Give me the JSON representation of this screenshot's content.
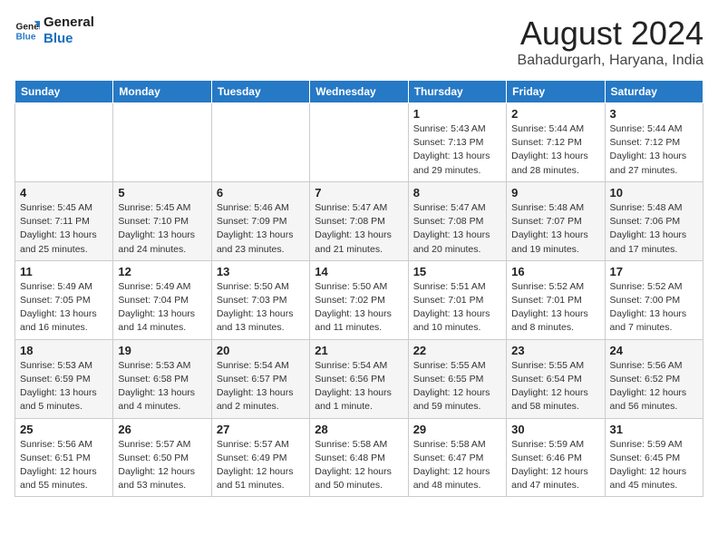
{
  "header": {
    "logo_line1": "General",
    "logo_line2": "Blue",
    "month": "August 2024",
    "location": "Bahadurgarh, Haryana, India"
  },
  "weekdays": [
    "Sunday",
    "Monday",
    "Tuesday",
    "Wednesday",
    "Thursday",
    "Friday",
    "Saturday"
  ],
  "weeks": [
    [
      {
        "day": "",
        "info": ""
      },
      {
        "day": "",
        "info": ""
      },
      {
        "day": "",
        "info": ""
      },
      {
        "day": "",
        "info": ""
      },
      {
        "day": "1",
        "info": "Sunrise: 5:43 AM\nSunset: 7:13 PM\nDaylight: 13 hours\nand 29 minutes."
      },
      {
        "day": "2",
        "info": "Sunrise: 5:44 AM\nSunset: 7:12 PM\nDaylight: 13 hours\nand 28 minutes."
      },
      {
        "day": "3",
        "info": "Sunrise: 5:44 AM\nSunset: 7:12 PM\nDaylight: 13 hours\nand 27 minutes."
      }
    ],
    [
      {
        "day": "4",
        "info": "Sunrise: 5:45 AM\nSunset: 7:11 PM\nDaylight: 13 hours\nand 25 minutes."
      },
      {
        "day": "5",
        "info": "Sunrise: 5:45 AM\nSunset: 7:10 PM\nDaylight: 13 hours\nand 24 minutes."
      },
      {
        "day": "6",
        "info": "Sunrise: 5:46 AM\nSunset: 7:09 PM\nDaylight: 13 hours\nand 23 minutes."
      },
      {
        "day": "7",
        "info": "Sunrise: 5:47 AM\nSunset: 7:08 PM\nDaylight: 13 hours\nand 21 minutes."
      },
      {
        "day": "8",
        "info": "Sunrise: 5:47 AM\nSunset: 7:08 PM\nDaylight: 13 hours\nand 20 minutes."
      },
      {
        "day": "9",
        "info": "Sunrise: 5:48 AM\nSunset: 7:07 PM\nDaylight: 13 hours\nand 19 minutes."
      },
      {
        "day": "10",
        "info": "Sunrise: 5:48 AM\nSunset: 7:06 PM\nDaylight: 13 hours\nand 17 minutes."
      }
    ],
    [
      {
        "day": "11",
        "info": "Sunrise: 5:49 AM\nSunset: 7:05 PM\nDaylight: 13 hours\nand 16 minutes."
      },
      {
        "day": "12",
        "info": "Sunrise: 5:49 AM\nSunset: 7:04 PM\nDaylight: 13 hours\nand 14 minutes."
      },
      {
        "day": "13",
        "info": "Sunrise: 5:50 AM\nSunset: 7:03 PM\nDaylight: 13 hours\nand 13 minutes."
      },
      {
        "day": "14",
        "info": "Sunrise: 5:50 AM\nSunset: 7:02 PM\nDaylight: 13 hours\nand 11 minutes."
      },
      {
        "day": "15",
        "info": "Sunrise: 5:51 AM\nSunset: 7:01 PM\nDaylight: 13 hours\nand 10 minutes."
      },
      {
        "day": "16",
        "info": "Sunrise: 5:52 AM\nSunset: 7:01 PM\nDaylight: 13 hours\nand 8 minutes."
      },
      {
        "day": "17",
        "info": "Sunrise: 5:52 AM\nSunset: 7:00 PM\nDaylight: 13 hours\nand 7 minutes."
      }
    ],
    [
      {
        "day": "18",
        "info": "Sunrise: 5:53 AM\nSunset: 6:59 PM\nDaylight: 13 hours\nand 5 minutes."
      },
      {
        "day": "19",
        "info": "Sunrise: 5:53 AM\nSunset: 6:58 PM\nDaylight: 13 hours\nand 4 minutes."
      },
      {
        "day": "20",
        "info": "Sunrise: 5:54 AM\nSunset: 6:57 PM\nDaylight: 13 hours\nand 2 minutes."
      },
      {
        "day": "21",
        "info": "Sunrise: 5:54 AM\nSunset: 6:56 PM\nDaylight: 13 hours\nand 1 minute."
      },
      {
        "day": "22",
        "info": "Sunrise: 5:55 AM\nSunset: 6:55 PM\nDaylight: 12 hours\nand 59 minutes."
      },
      {
        "day": "23",
        "info": "Sunrise: 5:55 AM\nSunset: 6:54 PM\nDaylight: 12 hours\nand 58 minutes."
      },
      {
        "day": "24",
        "info": "Sunrise: 5:56 AM\nSunset: 6:52 PM\nDaylight: 12 hours\nand 56 minutes."
      }
    ],
    [
      {
        "day": "25",
        "info": "Sunrise: 5:56 AM\nSunset: 6:51 PM\nDaylight: 12 hours\nand 55 minutes."
      },
      {
        "day": "26",
        "info": "Sunrise: 5:57 AM\nSunset: 6:50 PM\nDaylight: 12 hours\nand 53 minutes."
      },
      {
        "day": "27",
        "info": "Sunrise: 5:57 AM\nSunset: 6:49 PM\nDaylight: 12 hours\nand 51 minutes."
      },
      {
        "day": "28",
        "info": "Sunrise: 5:58 AM\nSunset: 6:48 PM\nDaylight: 12 hours\nand 50 minutes."
      },
      {
        "day": "29",
        "info": "Sunrise: 5:58 AM\nSunset: 6:47 PM\nDaylight: 12 hours\nand 48 minutes."
      },
      {
        "day": "30",
        "info": "Sunrise: 5:59 AM\nSunset: 6:46 PM\nDaylight: 12 hours\nand 47 minutes."
      },
      {
        "day": "31",
        "info": "Sunrise: 5:59 AM\nSunset: 6:45 PM\nDaylight: 12 hours\nand 45 minutes."
      }
    ]
  ]
}
